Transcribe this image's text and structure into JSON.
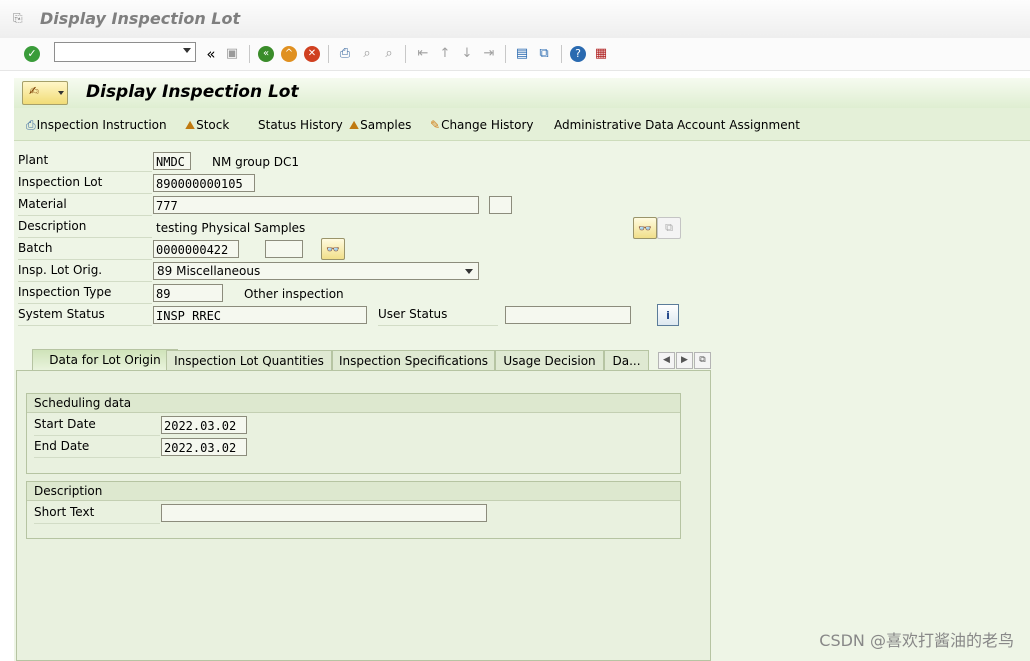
{
  "window": {
    "title": "Display Inspection Lot"
  },
  "toolbar": {
    "command_field": {
      "value": "",
      "placeholder": ""
    },
    "back_chevron": "«",
    "icons": [
      "enter-check-icon",
      "save-icon",
      "back-icon",
      "exit-icon",
      "cancel-icon",
      "print-icon",
      "find-icon",
      "find-next-icon",
      "first-page-icon",
      "previous-page-icon",
      "next-page-icon",
      "last-page-icon",
      "create-session-icon",
      "shortcut-icon",
      "help-icon",
      "customize-layout-icon"
    ]
  },
  "header": {
    "title": "Display Inspection Lot"
  },
  "appbar": {
    "buttons": [
      {
        "label": "Inspection Instruction",
        "icon": "printer-icon"
      },
      {
        "label": "Stock",
        "icon": "stock-icon"
      },
      {
        "label": "Status History",
        "icon": ""
      },
      {
        "label": "Samples",
        "icon": "samples-icon"
      },
      {
        "label": "Change History",
        "icon": "change-history-icon"
      },
      {
        "label": "Administrative Data",
        "icon": ""
      },
      {
        "label": "Account Assignment",
        "icon": ""
      }
    ]
  },
  "form": {
    "plant": {
      "label": "Plant",
      "value": "NMDC",
      "text": "NM group DC1"
    },
    "inspection_lot": {
      "label": "Inspection Lot",
      "value": "890000000105"
    },
    "material": {
      "label": "Material",
      "value": "777",
      "extra": ""
    },
    "description": {
      "label": "Description",
      "value": "testing Physical Samples"
    },
    "batch": {
      "label": "Batch",
      "value": "0000000422",
      "extra": ""
    },
    "insp_lot_orig": {
      "label": "Insp. Lot Orig.",
      "value": "89 Miscellaneous"
    },
    "inspection_type": {
      "label": "Inspection Type",
      "value": "89",
      "text": "Other inspection"
    },
    "system_status": {
      "label": "System Status",
      "value": "INSP RREC"
    },
    "user_status": {
      "label": "User Status",
      "value": ""
    }
  },
  "tabs": [
    {
      "label": "Data for Lot Origin",
      "active": true
    },
    {
      "label": "Inspection Lot Quantities",
      "active": false
    },
    {
      "label": "Inspection Specifications",
      "active": false
    },
    {
      "label": "Usage Decision",
      "active": false
    },
    {
      "label": "Da...",
      "active": false
    }
  ],
  "scheduling": {
    "title": "Scheduling data",
    "start_date": {
      "label": "Start Date",
      "value": "2022.03.02"
    },
    "end_date": {
      "label": "End Date",
      "value": "2022.03.02"
    }
  },
  "description_group": {
    "title": "Description",
    "short_text": {
      "label": "Short Text",
      "value": ""
    }
  },
  "watermark": "CSDN @喜欢打酱油的老鸟",
  "colors": {
    "panel_bg": "#eef5e6",
    "appbar_bg": "#e4f0d8",
    "accent": "#f1dc76"
  }
}
